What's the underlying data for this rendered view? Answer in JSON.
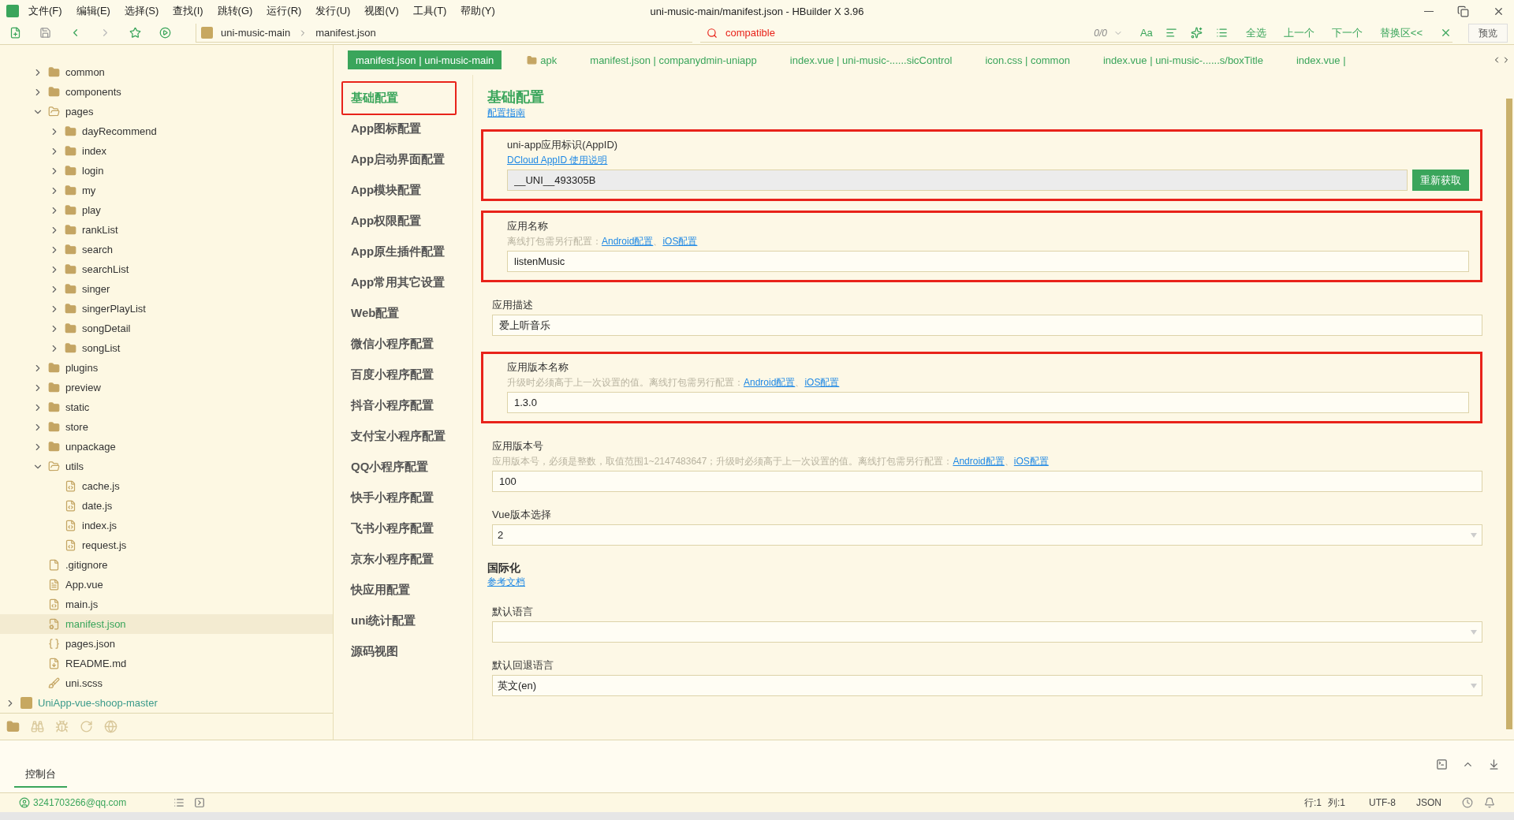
{
  "window": {
    "title": "uni-music-main/manifest.json - HBuilder X 3.96"
  },
  "menu": [
    "文件(F)",
    "编辑(E)",
    "选择(S)",
    "查找(I)",
    "跳转(G)",
    "运行(R)",
    "发行(U)",
    "视图(V)",
    "工具(T)",
    "帮助(Y)"
  ],
  "toolbar": {
    "breadcrumb": [
      "uni-music-main",
      "manifest.json"
    ],
    "search": {
      "value": "compatible",
      "count": "0/0",
      "case_toggle": "Aa",
      "actions": [
        "全选",
        "上一个",
        "下一个",
        "替换区<<"
      ]
    },
    "preview_button": "预览"
  },
  "file_tree": {
    "items": [
      {
        "name": "common",
        "kind": "folder",
        "expanded": false,
        "selected": false
      },
      {
        "name": "components",
        "kind": "folder",
        "expanded": false,
        "selected": false
      },
      {
        "name": "pages",
        "kind": "folder",
        "expanded": true,
        "selected": false,
        "children": [
          {
            "name": "dayRecommend",
            "kind": "folder",
            "expanded": false,
            "selected": false
          },
          {
            "name": "index",
            "kind": "folder",
            "expanded": false,
            "selected": false
          },
          {
            "name": "login",
            "kind": "folder",
            "expanded": false,
            "selected": false
          },
          {
            "name": "my",
            "kind": "folder",
            "expanded": false,
            "selected": false
          },
          {
            "name": "play",
            "kind": "folder",
            "expanded": false,
            "selected": false
          },
          {
            "name": "rankList",
            "kind": "folder",
            "expanded": false,
            "selected": false
          },
          {
            "name": "search",
            "kind": "folder",
            "expanded": false,
            "selected": false
          },
          {
            "name": "searchList",
            "kind": "folder",
            "expanded": false,
            "selected": false
          },
          {
            "name": "singer",
            "kind": "folder",
            "expanded": false,
            "selected": false
          },
          {
            "name": "singerPlayList",
            "kind": "folder",
            "expanded": false,
            "selected": false
          },
          {
            "name": "songDetail",
            "kind": "folder",
            "expanded": false,
            "selected": false
          },
          {
            "name": "songList",
            "kind": "folder",
            "expanded": false,
            "selected": false
          }
        ]
      },
      {
        "name": "plugins",
        "kind": "folder",
        "expanded": false,
        "selected": false
      },
      {
        "name": "preview",
        "kind": "folder",
        "expanded": false,
        "selected": false
      },
      {
        "name": "static",
        "kind": "folder",
        "expanded": false,
        "selected": false
      },
      {
        "name": "store",
        "kind": "folder",
        "expanded": false,
        "selected": false
      },
      {
        "name": "unpackage",
        "kind": "folder",
        "expanded": false,
        "selected": false
      },
      {
        "name": "utils",
        "kind": "folder",
        "expanded": true,
        "selected": false,
        "children": [
          {
            "name": "cache.js",
            "kind": "script",
            "selected": false
          },
          {
            "name": "date.js",
            "kind": "script",
            "selected": false
          },
          {
            "name": "index.js",
            "kind": "script",
            "selected": false
          },
          {
            "name": "request.js",
            "kind": "script",
            "selected": false
          }
        ]
      },
      {
        "name": ".gitignore",
        "kind": "plain",
        "selected": false
      },
      {
        "name": "App.vue",
        "kind": "vue",
        "selected": false
      },
      {
        "name": "main.js",
        "kind": "script",
        "selected": false
      },
      {
        "name": "manifest.json",
        "kind": "config",
        "selected": true
      },
      {
        "name": "pages.json",
        "kind": "json",
        "selected": false
      },
      {
        "name": "README.md",
        "kind": "markdown",
        "selected": false
      },
      {
        "name": "uni.scss",
        "kind": "style",
        "selected": false
      }
    ],
    "other_projects": [
      {
        "name": "UniApp-vue-shoop-master",
        "expanded": false
      }
    ]
  },
  "editor_tabs": [
    {
      "label": "manifest.json | uni-music-main",
      "kind": "file",
      "selected": true
    },
    {
      "label": "apk",
      "kind": "folder",
      "selected": false
    },
    {
      "label": "manifest.json | companydmin-uniapp",
      "kind": "file",
      "selected": false
    },
    {
      "label": "index.vue | uni-music-......sicControl",
      "kind": "file",
      "selected": false
    },
    {
      "label": "icon.css | common",
      "kind": "file",
      "selected": false
    },
    {
      "label": "index.vue | uni-music-......s/boxTitle",
      "kind": "file",
      "selected": false
    },
    {
      "label": "index.vue |",
      "kind": "file",
      "selected": false
    }
  ],
  "settings_nav": [
    {
      "label": "基础配置",
      "selected": true
    },
    {
      "label": "App图标配置",
      "selected": false
    },
    {
      "label": "App启动界面配置",
      "selected": false
    },
    {
      "label": "App模块配置",
      "selected": false
    },
    {
      "label": "App权限配置",
      "selected": false
    },
    {
      "label": "App原生插件配置",
      "selected": false
    },
    {
      "label": "App常用其它设置",
      "selected": false
    },
    {
      "label": "Web配置",
      "selected": false
    },
    {
      "label": "微信小程序配置",
      "selected": false
    },
    {
      "label": "百度小程序配置",
      "selected": false
    },
    {
      "label": "抖音小程序配置",
      "selected": false
    },
    {
      "label": "支付宝小程序配置",
      "selected": false
    },
    {
      "label": "QQ小程序配置",
      "selected": false
    },
    {
      "label": "快手小程序配置",
      "selected": false
    },
    {
      "label": "飞书小程序配置",
      "selected": false
    },
    {
      "label": "京东小程序配置",
      "selected": false
    },
    {
      "label": "快应用配置",
      "selected": false
    },
    {
      "label": "uni统计配置",
      "selected": false
    },
    {
      "label": "源码视图",
      "selected": false
    }
  ],
  "form": {
    "sections": [
      {
        "kind": "page",
        "title": "基础配置",
        "link": "配置指南",
        "fields": [
          {
            "kind": "text",
            "label": "uni-app应用标识(AppID)",
            "link": "DCloud AppID 使用说明",
            "value": "__UNI__493305B",
            "button": "重新获取",
            "readonly": true,
            "highlighted": true
          },
          {
            "kind": "text",
            "label": "应用名称",
            "hint_parts": [
              {
                "kind": "plain",
                "text": "离线打包需另行配置："
              },
              {
                "kind": "link",
                "text": "Android配置"
              },
              {
                "kind": "plain",
                "text": "、"
              },
              {
                "kind": "link",
                "text": "iOS配置"
              }
            ],
            "value": "listenMusic",
            "readonly": false,
            "highlighted": true
          },
          {
            "kind": "text",
            "label": "应用描述",
            "value": "爱上听音乐",
            "readonly": false,
            "highlighted": false
          },
          {
            "kind": "text",
            "label": "应用版本名称",
            "hint_parts": [
              {
                "kind": "plain",
                "text": "升级时必须高于上一次设置的值。离线打包需另行配置："
              },
              {
                "kind": "link",
                "text": "Android配置"
              },
              {
                "kind": "plain",
                "text": "、"
              },
              {
                "kind": "link",
                "text": "iOS配置"
              }
            ],
            "value": "1.3.0",
            "readonly": false,
            "highlighted": true
          },
          {
            "kind": "text",
            "label": "应用版本号",
            "hint_parts": [
              {
                "kind": "plain",
                "text": "应用版本号，必须是整数，取值范围1~2147483647；升级时必须高于上一次设置的值。离线打包需另行配置："
              },
              {
                "kind": "link",
                "text": "Android配置"
              },
              {
                "kind": "plain",
                "text": "、"
              },
              {
                "kind": "link",
                "text": "iOS配置"
              }
            ],
            "value": "100",
            "readonly": false,
            "highlighted": false
          },
          {
            "kind": "select",
            "label": "Vue版本选择",
            "value": "2",
            "highlighted": false
          }
        ]
      },
      {
        "kind": "group",
        "title": "国际化",
        "link": "参考文档",
        "fields": [
          {
            "kind": "select",
            "label": "默认语言",
            "highlighted": false
          },
          {
            "kind": "select",
            "label": "默认回退语言",
            "value": "英文(en)",
            "highlighted": false
          }
        ]
      }
    ]
  },
  "console": {
    "tab": "控制台"
  },
  "status_bar": {
    "user": "3241703266@qq.com",
    "line": "行:1",
    "column": "列:1",
    "encoding": "UTF-8",
    "language": "JSON"
  }
}
